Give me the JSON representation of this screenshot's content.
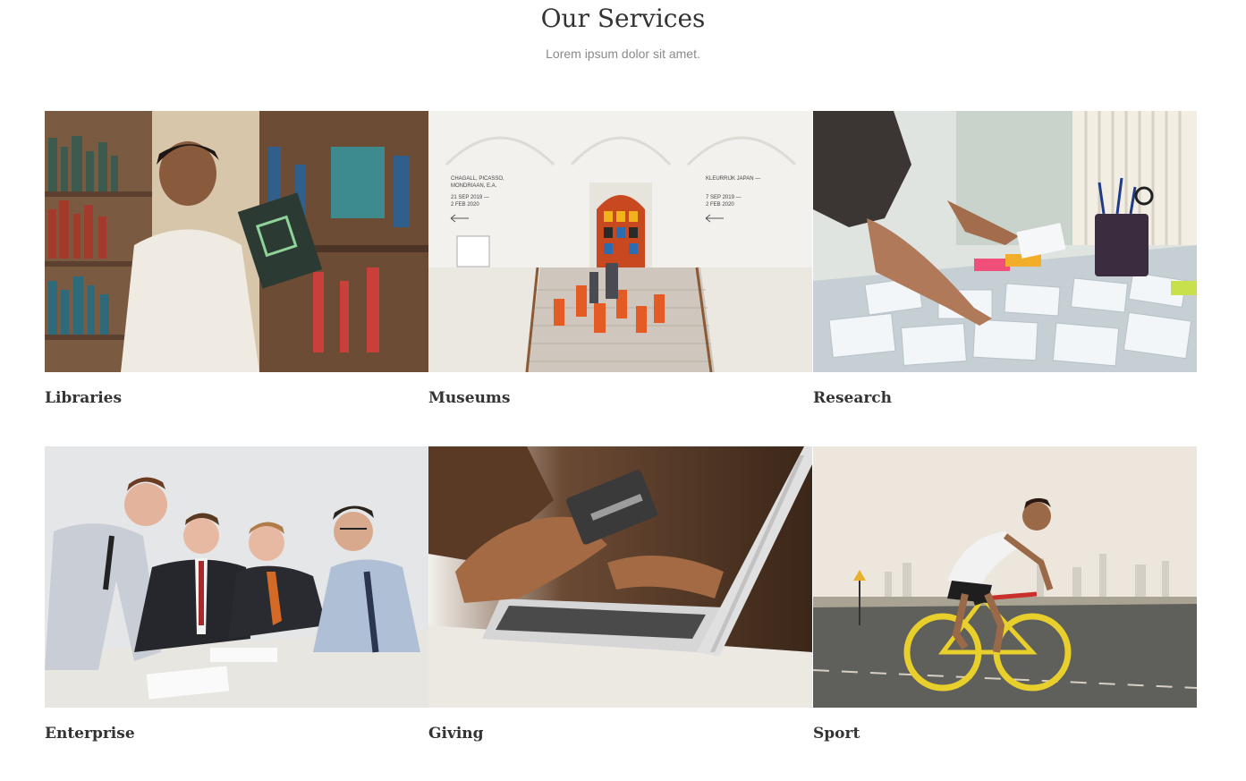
{
  "header": {
    "title": "Our Services",
    "subtitle": "Lorem ipsum dolor sit amet."
  },
  "services": [
    {
      "label": "Libraries",
      "image_icon": "library-photo-icon",
      "colors": {
        "bg": "#c9b79c",
        "shelf": "#6b4a33",
        "accent": "#2f5b4f",
        "shirt": "#efeae2",
        "skin": "#8a5a3c"
      }
    },
    {
      "label": "Museums",
      "image_icon": "museum-photo-icon",
      "colors": {
        "bg": "#f3f1ee",
        "stairs": "#cfc7bd",
        "doorway": "#c8491f",
        "crowd": "#e45b24"
      },
      "wall_text": {
        "left": [
          "CHAGALL, PICASSO,",
          "MONDRIAAN, E.A.",
          "",
          "21 SEP 2019 —",
          "2 FEB 2020"
        ],
        "right": [
          "KLEURRIJK JAPAN —",
          "",
          "7 SEP 2019 —",
          "2 FEB 2020"
        ]
      }
    },
    {
      "label": "Research",
      "image_icon": "research-photo-icon",
      "colors": {
        "bg": "#d9e0dc",
        "paper": "#f2f5f7",
        "table": "#cbd3d6",
        "skin": "#b07a5a"
      }
    },
    {
      "label": "Enterprise",
      "image_icon": "enterprise-photo-icon",
      "colors": {
        "bg": "#e4e6e7",
        "suit": "#2a2b30",
        "shirt": "#c9ced6",
        "table": "#e8e6e1",
        "tie": "#b03030"
      }
    },
    {
      "label": "Giving",
      "image_icon": "giving-photo-icon",
      "colors": {
        "bg": "#5a3a24",
        "laptop": "#d8d8d8",
        "card": "#3a3a3a",
        "skin": "#a36a43"
      }
    },
    {
      "label": "Sport",
      "image_icon": "sport-photo-icon",
      "colors": {
        "sky": "#e9e3da",
        "road": "#5f5f5c",
        "bike": "#e8cf2c",
        "rider": "#f2f2f2"
      }
    }
  ]
}
